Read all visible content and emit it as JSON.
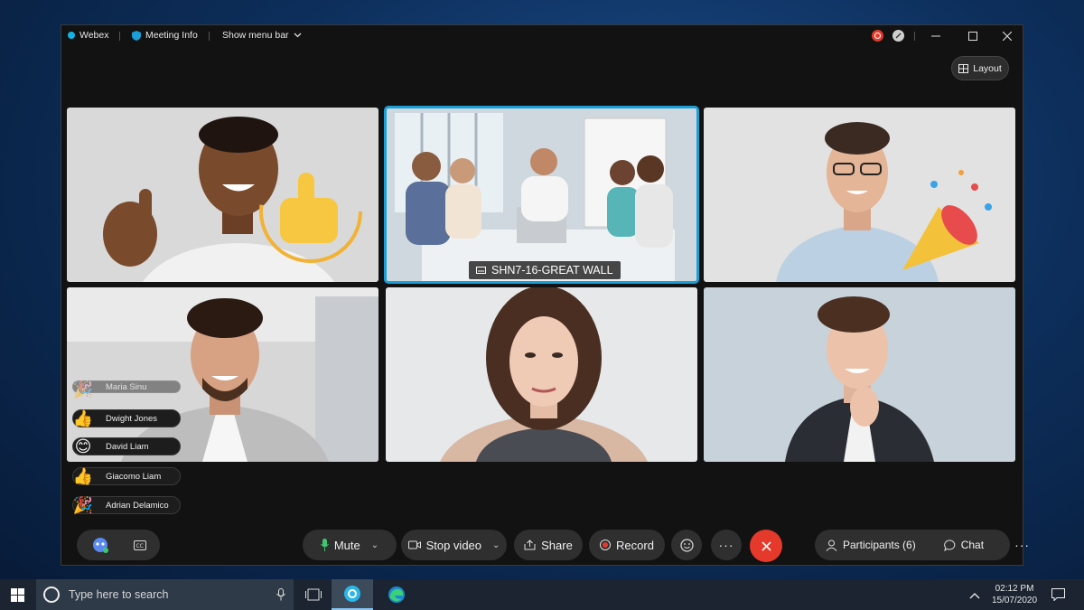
{
  "titlebar": {
    "app_name": "Webex",
    "meeting_info": "Meeting Info",
    "show_menu_bar": "Show menu bar"
  },
  "layout_button": "Layout",
  "room_label": "SHN7-16-GREAT WALL",
  "reactions": [
    {
      "name": "Maria Sinu",
      "icon": "party-popper-icon"
    },
    {
      "name": "Dwight Jones",
      "icon": "thumbs-up-icon"
    },
    {
      "name": "David Liam",
      "icon": "smile-icon"
    },
    {
      "name": "Giacomo Liam",
      "icon": "thumbs-up-icon"
    },
    {
      "name": "Adrian Delamico",
      "icon": "party-popper-icon"
    }
  ],
  "controls": {
    "mute": "Mute",
    "stop_video": "Stop video",
    "share": "Share",
    "record": "Record",
    "participants": "Participants (6)",
    "chat": "Chat"
  },
  "taskbar": {
    "search_placeholder": "Type here to search",
    "time": "02:12 PM",
    "date": "15/07/2020"
  },
  "colors": {
    "accent": "#1a9fd6",
    "end_call": "#e5392b",
    "record_dot": "#e5392b"
  }
}
